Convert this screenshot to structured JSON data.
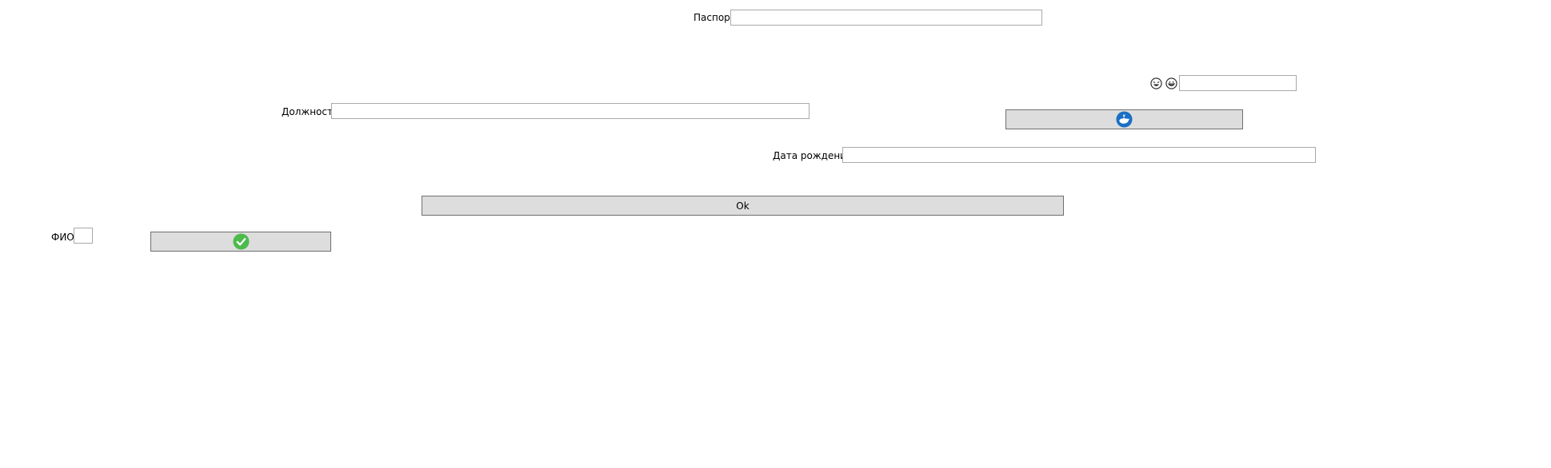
{
  "form": {
    "passport_label": "Паспорт",
    "passport_value": "",
    "extra_value": "",
    "position_label": "Должность",
    "position_value": "",
    "birthdate_label": "Дата рождения",
    "birthdate_value": "",
    "ok_label": "Ok",
    "fio_label": "ФИО",
    "fio_value": ""
  },
  "icons": {
    "emoji_1": "laughing-face-icon",
    "emoji_2": "grinning-face-icon",
    "whale_button_icon": "whale-icon",
    "check_button_icon": "checkmark-icon"
  },
  "colors": {
    "button_bg": "#dddddd",
    "whale_icon_bg": "#1a6fc4",
    "check_icon_bg": "#4cbb4c"
  }
}
